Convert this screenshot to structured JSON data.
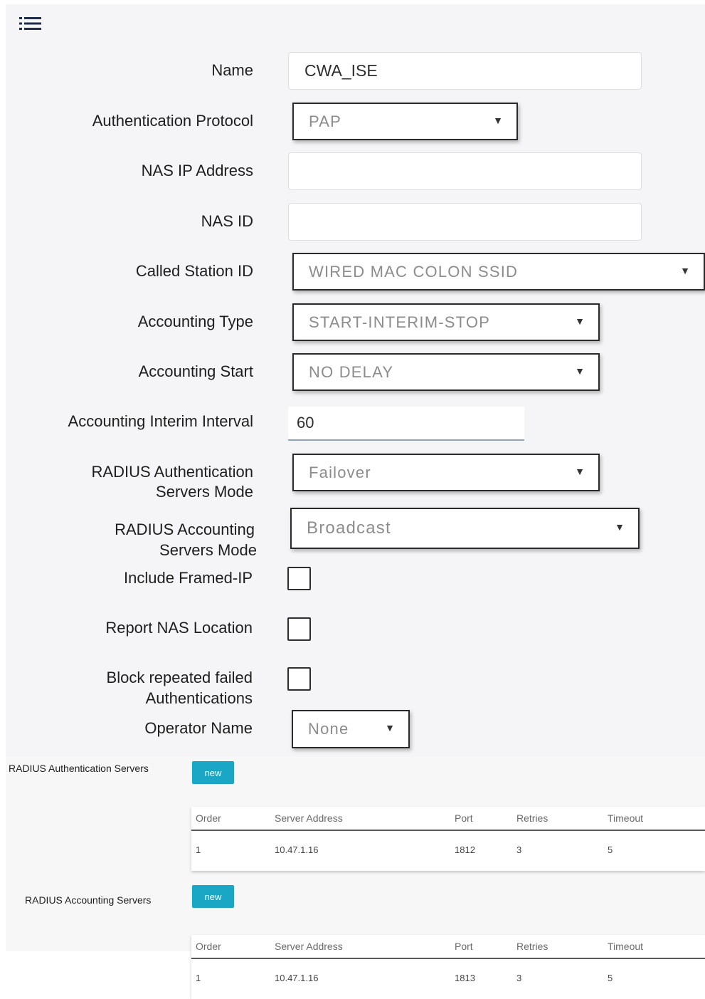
{
  "menu": {
    "icon": "list-menu-icon"
  },
  "form": {
    "name": {
      "label": "Name",
      "value": "CWA_ISE"
    },
    "auth_protocol": {
      "label": "Authentication Protocol",
      "value": "PAP"
    },
    "nas_ip": {
      "label": "NAS IP Address",
      "value": ""
    },
    "nas_id": {
      "label": "NAS ID",
      "value": ""
    },
    "called_station_id": {
      "label": "Called Station ID",
      "value": "WIRED MAC COLON SSID"
    },
    "accounting_type": {
      "label": "Accounting Type",
      "value": "START-INTERIM-STOP"
    },
    "accounting_start": {
      "label": "Accounting Start",
      "value": "NO DELAY"
    },
    "interim_interval": {
      "label": "Accounting Interim Interval",
      "value": "60"
    },
    "radius_auth_mode": {
      "label_line1": "RADIUS Authentication",
      "label_line2": "Servers Mode",
      "value": "Failover"
    },
    "radius_acct_mode": {
      "label_line1": "RADIUS Accounting",
      "label_line2": "Servers Mode",
      "value": "Broadcast"
    },
    "include_framed_ip": {
      "label": "Include Framed-IP",
      "checked": false
    },
    "report_nas_location": {
      "label": "Report NAS Location",
      "checked": false
    },
    "block_failed_auth": {
      "label_line1": "Block repeated failed",
      "label_line2": "Authentications",
      "checked": false
    },
    "operator_name": {
      "label": "Operator Name",
      "value": "None"
    }
  },
  "auth_servers": {
    "title": "RADIUS Authentication Servers",
    "new_label": "new",
    "columns": [
      "Order",
      "Server Address",
      "Port",
      "Retries",
      "Timeout"
    ],
    "rows": [
      [
        "1",
        "10.47.1.16",
        "1812",
        "3",
        "5"
      ]
    ]
  },
  "acct_servers": {
    "title": "RADIUS Accounting Servers",
    "new_label": "new",
    "columns": [
      "Order",
      "Server Address",
      "Port",
      "Retries",
      "Timeout"
    ],
    "rows": [
      [
        "1",
        "10.47.1.16",
        "1813",
        "3",
        "5"
      ]
    ]
  },
  "colors": {
    "accent": "#1aa7c6",
    "panel_bg": "#f5f5f7",
    "select_border": "#2a2a2a"
  }
}
